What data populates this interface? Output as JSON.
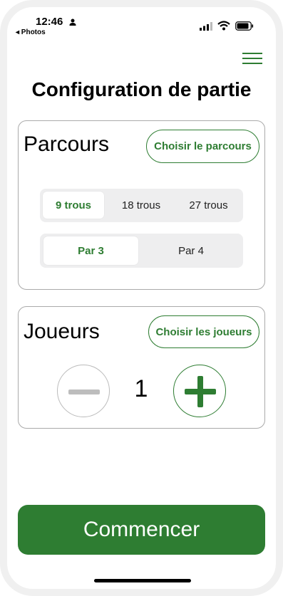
{
  "status_bar": {
    "time": "12:46",
    "back_app": "◂ Photos"
  },
  "page": {
    "title": "Configuration de partie"
  },
  "course_card": {
    "title": "Parcours",
    "choose_button": "Choisir le parcours",
    "holes": {
      "options": [
        "9 trous",
        "18 trous",
        "27 trous"
      ],
      "selected": "9 trous"
    },
    "par": {
      "options": [
        "Par 3",
        "Par 4"
      ],
      "selected": "Par 3"
    }
  },
  "players_card": {
    "title": "Joueurs",
    "choose_button": "Choisir les joueurs",
    "count": "1"
  },
  "start_button": "Commencer",
  "colors": {
    "accent": "#2e7d32",
    "disabled": "#bdbdbd",
    "segment_bg": "#eeeeef"
  },
  "icons": [
    "person-icon",
    "signal-icon",
    "wifi-icon",
    "battery-icon",
    "menu-icon",
    "minus-icon",
    "plus-icon"
  ]
}
